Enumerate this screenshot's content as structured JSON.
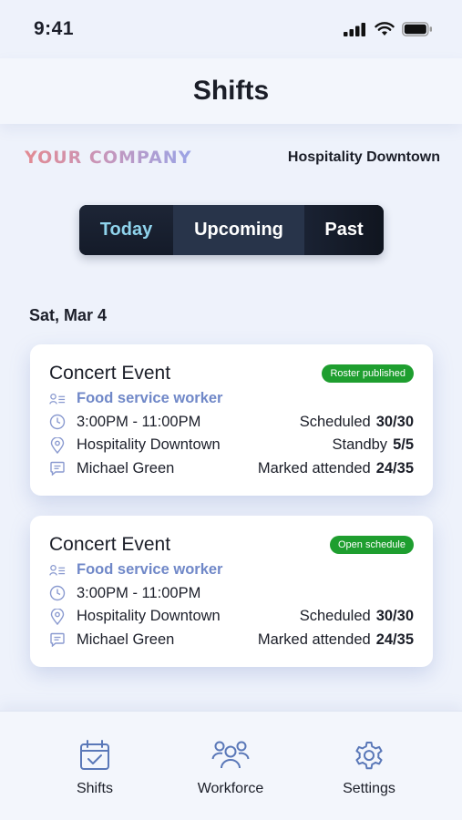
{
  "status": {
    "time": "9:41"
  },
  "header": {
    "title": "Shifts"
  },
  "company": {
    "logo_text": "YOUR COMPANY",
    "location": "Hospitality Downtown"
  },
  "tabs": [
    {
      "label": "Today",
      "selected": true
    },
    {
      "label": "Upcoming",
      "selected": false
    },
    {
      "label": "Past",
      "selected": false
    }
  ],
  "date_heading": "Sat, Mar 4",
  "cards": [
    {
      "title": "Concert Event",
      "badge": "Roster published",
      "role": "Food service worker",
      "time": "3:00PM - 11:00PM",
      "location": "Hospitality Downtown",
      "manager": "Michael Green",
      "stats": [
        {
          "label": "Scheduled",
          "value": "30/30"
        },
        {
          "label": "Standby",
          "value": "5/5"
        },
        {
          "label": "Marked attended",
          "value": "24/35"
        }
      ]
    },
    {
      "title": "Concert Event",
      "badge": "Open schedule",
      "role": "Food service worker",
      "time": "3:00PM - 11:00PM",
      "location": "Hospitality Downtown",
      "manager": "Michael Green",
      "stats": [
        {
          "label": "Scheduled",
          "value": "30/30"
        },
        {
          "label": "Marked attended",
          "value": "24/35"
        }
      ]
    }
  ],
  "nav": [
    {
      "label": "Shifts",
      "icon": "calendar-check-icon"
    },
    {
      "label": "Workforce",
      "icon": "people-group-icon"
    },
    {
      "label": "Settings",
      "icon": "gear-icon"
    }
  ],
  "colors": {
    "badge_green": "#1e9e2f",
    "role_blue": "#7088c8",
    "tab_dark": "#1a2233",
    "today_accent": "#8fd3ec"
  }
}
